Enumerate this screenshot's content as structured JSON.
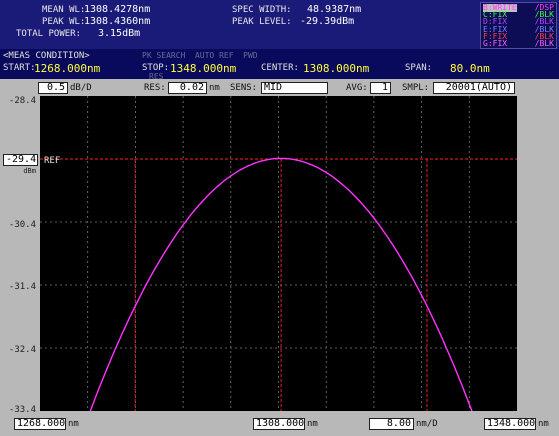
{
  "header": {
    "mean_wl_label": "MEAN WL:",
    "mean_wl_value": "1308.4278nm",
    "peak_wl_label": "PEAK WL:",
    "peak_wl_value": "1308.4360nm",
    "total_power_label": "TOTAL POWER:",
    "total_power_value": "3.15dBm",
    "spec_width_label": "SPEC WIDTH:",
    "spec_width_value": "48.9387nm",
    "peak_level_label": "PEAK LEVEL:",
    "peak_level_value": "-29.39dBm"
  },
  "traces": [
    {
      "name": "B:WRITE",
      "mode": "/DSP",
      "color": "#ff40ff"
    },
    {
      "name": "C:FIX",
      "mode": "/BLK",
      "color": "#40ff40"
    },
    {
      "name": "D:FIX",
      "mode": "/BLK",
      "color": "#c040ff"
    },
    {
      "name": "E:FIX",
      "mode": "/BLK",
      "color": "#8080ff"
    },
    {
      "name": "F:FIX",
      "mode": "/BLK",
      "color": "#ff4040"
    },
    {
      "name": "G:FIX",
      "mode": "/BLK",
      "color": "#ff60ff"
    }
  ],
  "condition": {
    "title": "<MEAS CONDITION>",
    "start_label": "START:",
    "start_value": "1268.000nm",
    "stop_label": "STOP:",
    "stop_value": "1348.000nm",
    "center_label": "CENTER:",
    "center_value": "1308.000nm",
    "span_label": "SPAN:",
    "span_value": "80.0nm",
    "faint_top": "PK SEARCH  AUTO REF  PWD",
    "faint_res": "RES"
  },
  "settings": {
    "scale_value": "0.5",
    "scale_unit": "dB/D",
    "res_label": "RES:",
    "res_value": "0.02",
    "res_unit": "nm",
    "sens_label": "SENS:",
    "sens_value": "MID",
    "avg_label": "AVG:",
    "avg_value": "1",
    "smpl_label": "SMPL:",
    "smpl_value": "20001(AUTO)"
  },
  "y_axis": {
    "top": "-28.4",
    "ref_value": "-29.4",
    "ref_unit": "dBm",
    "ref_tag": "REF",
    "ticks": [
      "-30.4",
      "-31.4",
      "-32.4",
      "-33.4"
    ]
  },
  "x_axis": {
    "start_value": "1268.000",
    "start_unit": "nm",
    "center_value": "1308.000",
    "center_unit": "nm",
    "div_value": "8.00",
    "div_unit": "nm/D",
    "stop_value": "1348.000",
    "stop_unit": "nm"
  },
  "colors": {
    "trace": "#ff33ff",
    "markers": "#ff2020",
    "grid": "#7a7a7a"
  }
}
